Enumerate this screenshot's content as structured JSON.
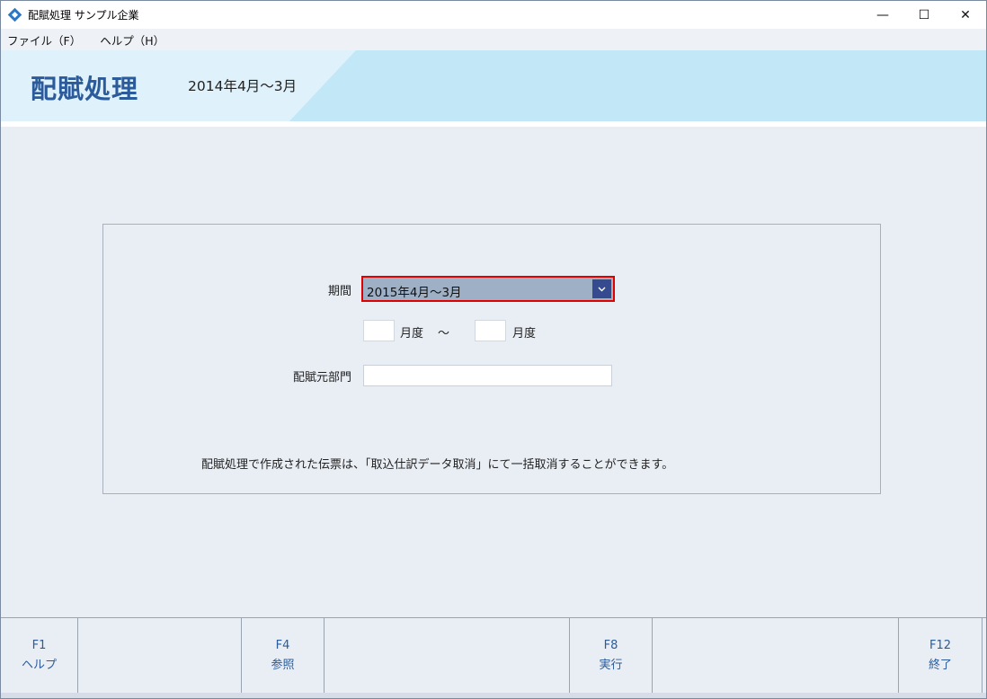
{
  "window": {
    "title": "配賦処理 サンプル企業",
    "controls": {
      "minimize": "—",
      "maximize": "☐",
      "close": "✕"
    }
  },
  "menu": {
    "items": [
      {
        "label": "ファイル（F）"
      },
      {
        "label": "ヘルプ（H）"
      }
    ]
  },
  "header": {
    "title": "配賦処理",
    "period": "2014年4月～3月"
  },
  "form": {
    "period_label": "期間",
    "period_value": "2015年4月～3月",
    "month_from_value": "",
    "month_unit_1": "月度",
    "range_sep": "～",
    "month_to_value": "",
    "month_unit_2": "月度",
    "source_dept_label": "配賦元部門",
    "source_dept_value": "",
    "note": "配賦処理で作成された伝票は、「取込仕訳データ取消」にて一括取消することができます。"
  },
  "fkeys": [
    {
      "key": "F1",
      "label": "ヘルプ"
    },
    {
      "key": "F4",
      "label": "参照"
    },
    {
      "key": "F8",
      "label": "実行"
    },
    {
      "key": "F12",
      "label": "終了"
    }
  ],
  "colors": {
    "header_text": "#2b5b9a",
    "combo_border": "#e00000",
    "combo_fill": "#9eb0c6",
    "combo_button": "#364a8f",
    "fkey_text": "#2b5b9a"
  }
}
